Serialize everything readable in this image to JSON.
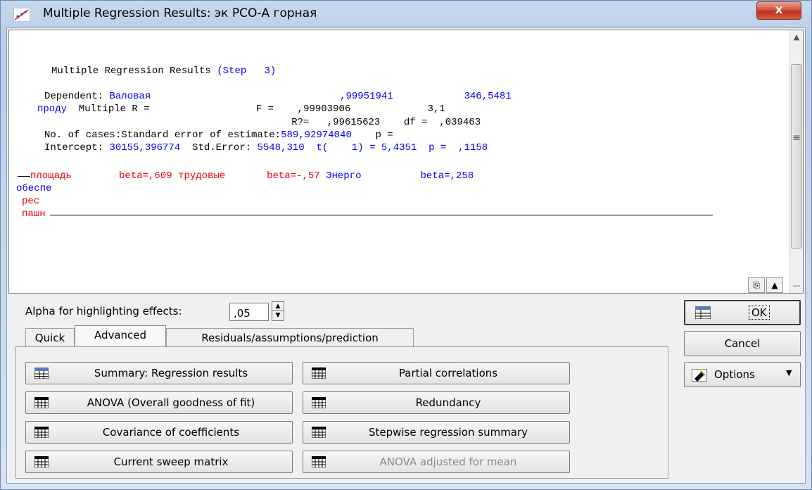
{
  "window": {
    "title": "Multiple Regression Results: эк РСО-А горная",
    "close_label": "x"
  },
  "output": {
    "line1": {
      "a": "Multiple Regression Results ",
      "b": "(Step   3)"
    },
    "line2": {
      "a": "Dependent: ",
      "b": "Валовая",
      "c": "                                ,99951941            346,5481"
    },
    "line3": {
      "a": "проду",
      "b": "  Multiple R =                  F =    ,99903906             3,1"
    },
    "line4": {
      "a": "                                           R?=   ,99615623    df =  ,039463"
    },
    "line5": {
      "a": "No. of cases:Standard error of estimate:",
      "b": "589,92974040",
      "c": "    p ="
    },
    "line6": {
      "a": "Intercept: ",
      "b": "30155,396774",
      "c": "  Std.Error: ",
      "d": "5548,310  t(    1) = 5,4351  p =  ,1158"
    },
    "line7": {
      "a": "площадь",
      "b": "        beta=,609 ",
      "c": "трудовые",
      "d": "       beta=-,57 ",
      "e": "Энерго",
      "f": "          beta=,258"
    },
    "line8": "обеспе",
    "line9": "рес",
    "line10": "пашн"
  },
  "alpha": {
    "label": "Alpha for highlighting effects:",
    "value": ",05"
  },
  "tabs": [
    "Quick",
    "Advanced",
    "Residuals/assumptions/prediction"
  ],
  "buttons": {
    "summary": "Summary:  Regression results",
    "partial": "Partial correlations",
    "anova": "ANOVA (Overall goodness of fit)",
    "redundancy": "Redundancy",
    "covariance": "Covariance of coefficients",
    "stepwise": "Stepwise regression summary",
    "sweep": "Current sweep matrix",
    "anova_mean": "ANOVA adjusted for mean"
  },
  "side": {
    "ok": "OK",
    "cancel": "Cancel",
    "options": "Options"
  }
}
